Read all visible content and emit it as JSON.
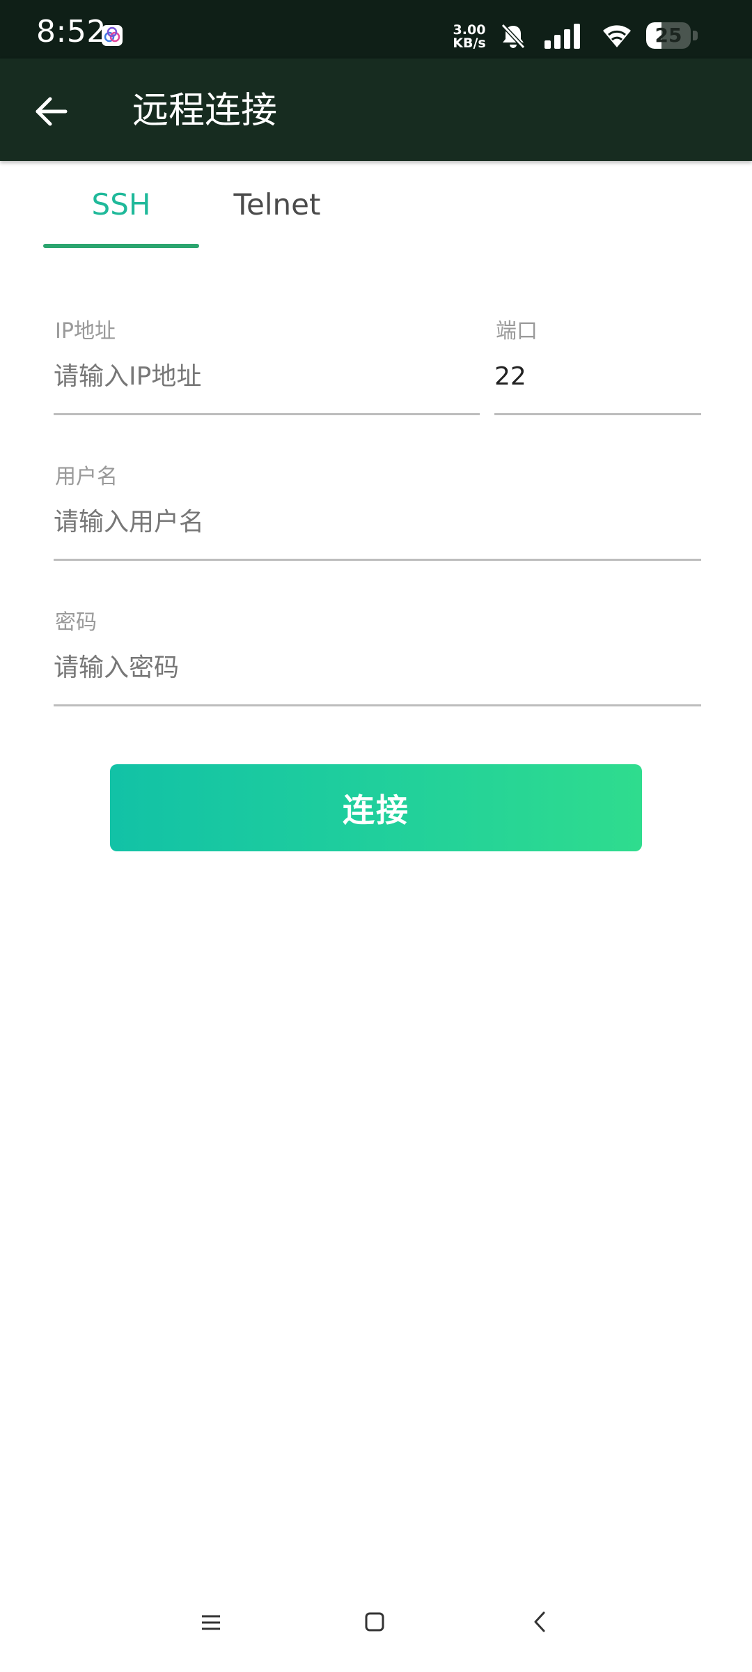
{
  "status_bar": {
    "time": "8:52",
    "speed_value": "3.00",
    "speed_unit": "KB/s",
    "battery_level": "25"
  },
  "app_bar": {
    "title": "远程连接",
    "back_icon": "arrow-left-icon"
  },
  "tabs": [
    {
      "label": "SSH",
      "selected": true
    },
    {
      "label": "Telnet",
      "selected": false
    }
  ],
  "form": {
    "ip": {
      "label": "IP地址",
      "placeholder": "请输入IP地址",
      "value": ""
    },
    "port": {
      "label": "端口",
      "placeholder": "",
      "value": "22"
    },
    "username": {
      "label": "用户名",
      "placeholder": "请输入用户名",
      "value": ""
    },
    "password": {
      "label": "密码",
      "placeholder": "请输入密码",
      "value": ""
    }
  },
  "connect_button": "连接",
  "colors": {
    "app_bar_bg": "#172c20",
    "status_bar_bg": "#0f1f17",
    "tab_active": "#1fb99a",
    "tab_indicator": "#2ba56f",
    "button_gradient_start": "#12c2a6",
    "button_gradient_end": "#2fdc8e"
  },
  "nav_bar": [
    "menu-icon",
    "home-icon",
    "back-icon"
  ]
}
